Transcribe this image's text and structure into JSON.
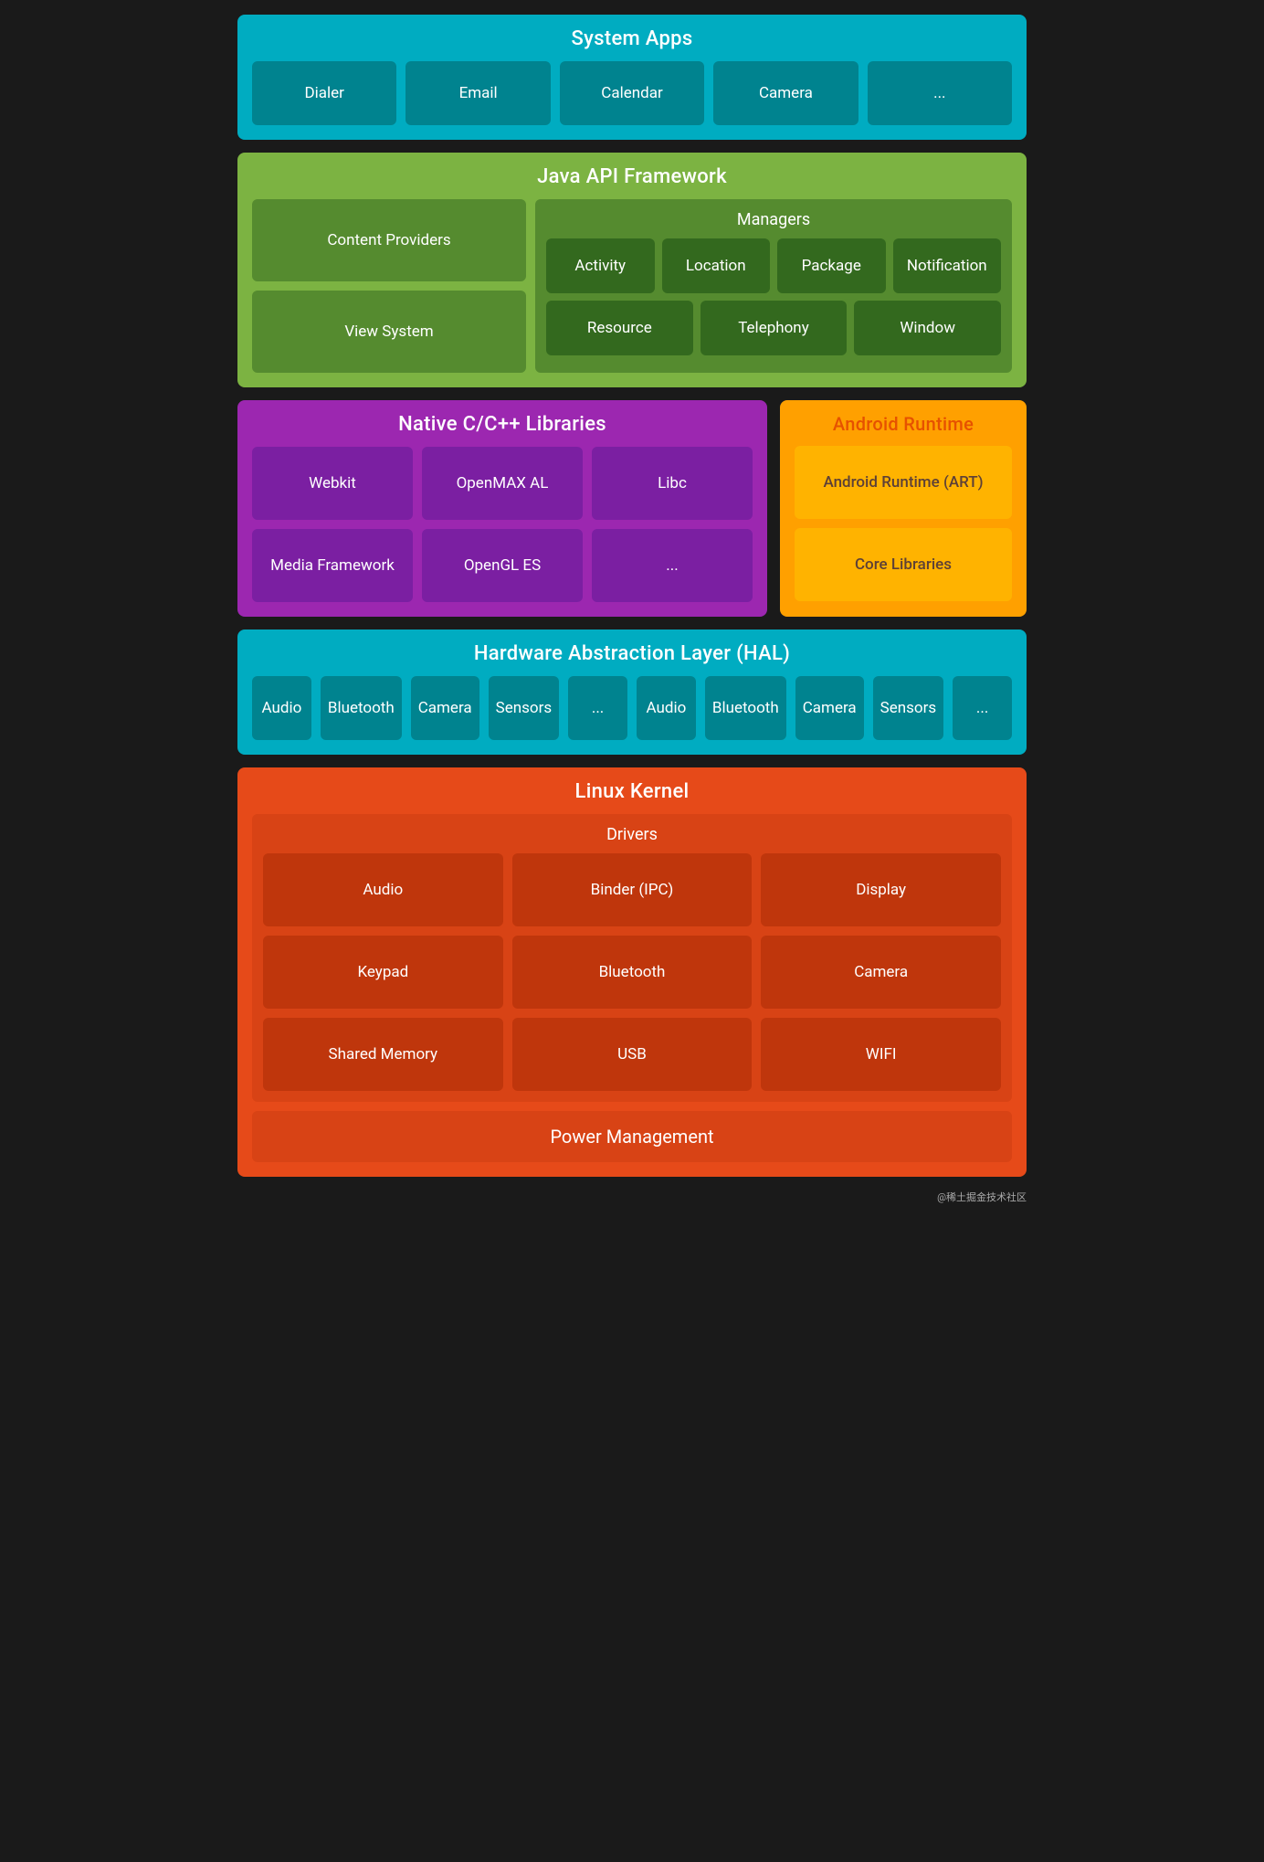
{
  "systemApps": {
    "title": "System Apps",
    "cards": [
      "Dialer",
      "Email",
      "Calendar",
      "Camera",
      "..."
    ]
  },
  "javaApi": {
    "title": "Java API Framework",
    "left": [
      "Content Providers",
      "View System"
    ],
    "managers": {
      "title": "Managers",
      "row1": [
        "Activity",
        "Location",
        "Package",
        "Notification"
      ],
      "row2": [
        "Resource",
        "Telephony",
        "Window"
      ]
    }
  },
  "nativeLibs": {
    "title": "Native C/C++ Libraries",
    "cards": [
      "Webkit",
      "OpenMAX AL",
      "Libc",
      "Media Framework",
      "OpenGL ES",
      "..."
    ]
  },
  "androidRuntime": {
    "title": "Android Runtime",
    "cards": [
      "Android Runtime (ART)",
      "Core Libraries"
    ]
  },
  "hal": {
    "title": "Hardware Abstraction Layer (HAL)",
    "cards": [
      "Audio",
      "Bluetooth",
      "Camera",
      "Sensors",
      "..."
    ]
  },
  "linuxKernel": {
    "title": "Linux Kernel",
    "drivers": {
      "title": "Drivers",
      "cards": [
        "Audio",
        "Binder (IPC)",
        "Display",
        "Keypad",
        "Bluetooth",
        "Camera",
        "Shared Memory",
        "USB",
        "WIFI"
      ]
    },
    "powerManagement": "Power Management"
  },
  "watermark": "@稀土掘金技术社区"
}
